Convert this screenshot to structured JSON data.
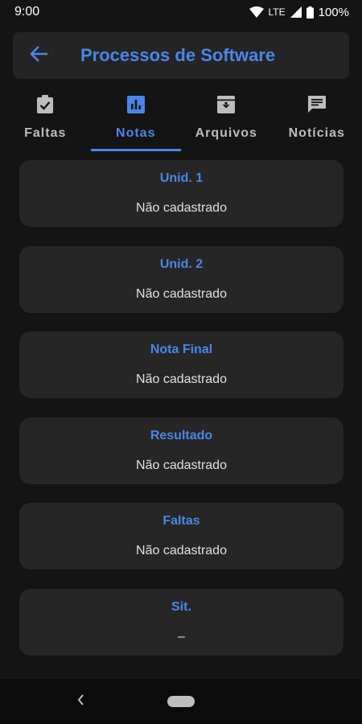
{
  "status_bar": {
    "time": "9:00",
    "network": "LTE",
    "battery": "100%",
    "icons": [
      "wifi-icon",
      "signal-icon",
      "battery-icon"
    ]
  },
  "app_bar": {
    "title": "Processos de Software",
    "back_icon": "arrow-left-icon"
  },
  "tabs": [
    {
      "label": "Faltas",
      "icon": "clipboard-check-icon",
      "active": false
    },
    {
      "label": "Notas",
      "icon": "bar-chart-icon",
      "active": true
    },
    {
      "label": "Arquivos",
      "icon": "archive-icon",
      "active": false
    },
    {
      "label": "Notícias",
      "icon": "message-icon",
      "active": false
    }
  ],
  "cards": [
    {
      "title": "Unid. 1",
      "value": "Não cadastrado"
    },
    {
      "title": "Unid. 2",
      "value": "Não cadastrado"
    },
    {
      "title": "Nota Final",
      "value": "Não cadastrado"
    },
    {
      "title": "Resultado",
      "value": "Não cadastrado"
    },
    {
      "title": "Faltas",
      "value": "Não cadastrado"
    },
    {
      "title": "Sit.",
      "value": "–"
    }
  ],
  "colors": {
    "accent": "#4a86e8",
    "background": "#141414",
    "surface": "#262626"
  }
}
